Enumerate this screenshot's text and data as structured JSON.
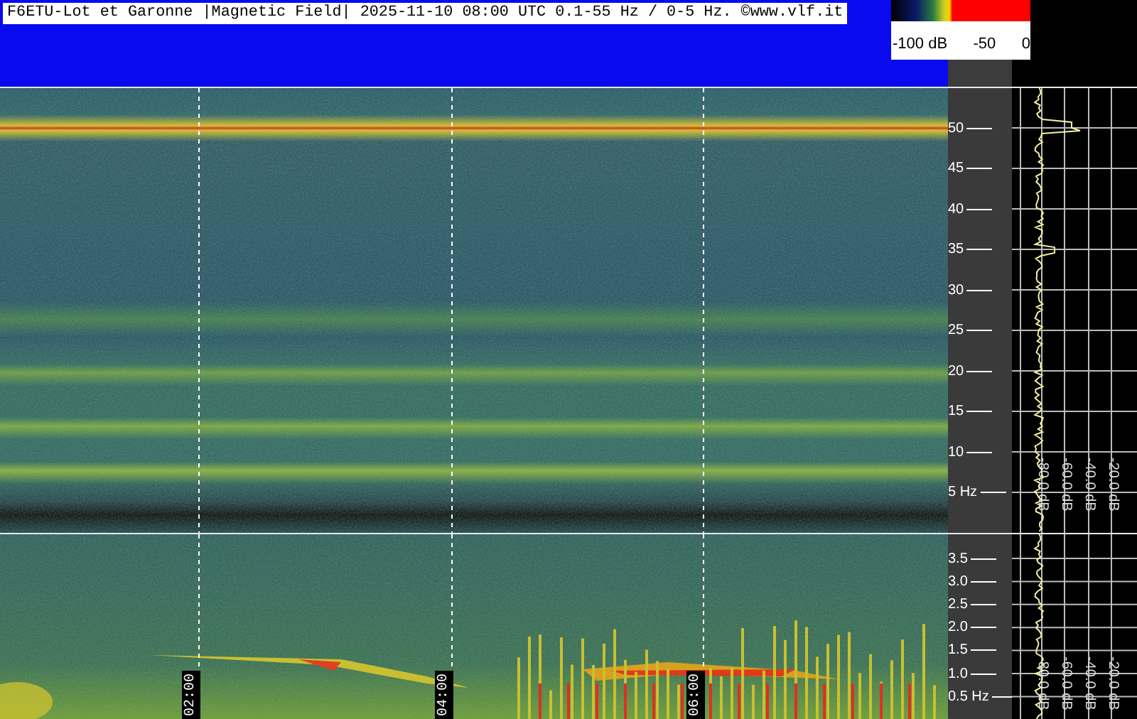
{
  "header": {
    "title": "F6ETU-Lot et Garonne |Magnetic Field| 2025-11-10 08:00 UTC 0.1-55 Hz / 0-5 Hz. ©www.vlf.it"
  },
  "color_scale": {
    "labels": [
      "-100 dB",
      "-50",
      "0"
    ]
  },
  "time_marks": [
    "02:00",
    "04:00",
    "06:00"
  ],
  "upper_panel": {
    "axis_labels": [
      "50",
      "45",
      "40",
      "35",
      "30",
      "25",
      "20",
      "15",
      "10",
      "5 Hz"
    ],
    "db_labels": [
      "-80.0 dB",
      "-60.0 dB",
      "-40.0 dB",
      "-20.0 dB"
    ]
  },
  "lower_panel": {
    "axis_labels": [
      "3.5",
      "3.0",
      "2.5",
      "2.0",
      "1.5",
      "1.0",
      "0.5 Hz"
    ],
    "db_labels": [
      "-80.0 dB",
      "-60.0 dB",
      "-40.0 dB",
      "-20.0 dB"
    ]
  }
}
